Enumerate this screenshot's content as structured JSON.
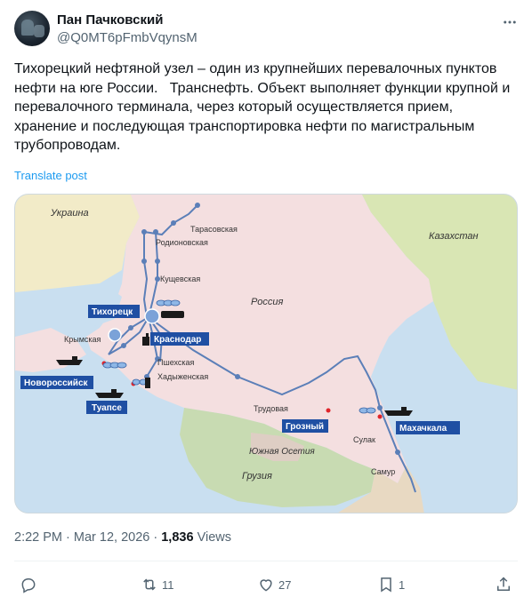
{
  "author": {
    "name": "Пан Пачковский",
    "handle": "@Q0MT6pFmbVqynsM"
  },
  "tweet": {
    "text": "Тихорецкий нефтяной узел – один из крупнейших перевалочных пунктов нефти на юге России.   Транснефть. Объект выполняет функции крупной и перевалочного терминала, через который осуществляется прием, хранение и последующая транспортировка нефти по магистральным трубопроводам.",
    "translate_label": "Translate post"
  },
  "map": {
    "countries": {
      "ukraine": "Украина",
      "kazakhstan": "Казахстан",
      "russia": "Россия",
      "south_ossetia": "Южная Осетия",
      "georgia": "Грузия"
    },
    "cities": {
      "tarasovskaya": "Тарасовская",
      "rodionovskaya": "Родионовская",
      "kushchevskaya": "Кущевская",
      "krymskaya": "Крымская",
      "pshekhskaya": "Пшехская",
      "khadyzhenskaya": "Хадыженская",
      "trudovaya": "Трудовая",
      "sulak": "Сулак",
      "samur": "Самур"
    },
    "hubs": {
      "tikhoretsk": "Тихорецк",
      "krasnodar": "Краснодар",
      "novorossiysk": "Новороссийск",
      "tuapse": "Туапсе",
      "grozny": "Грозный",
      "makhachkala": "Махачкала"
    },
    "colors": {
      "land": "#f4dfe0",
      "sea": "#c9dff0",
      "ukraine": "#f2ebc8",
      "kazakhstan": "#d9e6b4",
      "georgia": "#c8dbb2",
      "pipeline": "#5b7fb8",
      "hub_label": "#1f4fa3"
    }
  },
  "meta": {
    "time": "2:22 PM",
    "date": "Mar 12, 2026",
    "views_count": "1,836",
    "views_label": "Views"
  },
  "actions": {
    "reply_icon": "reply-icon",
    "retweet_count": "11",
    "like_count": "27",
    "bookmark_count": "1"
  }
}
